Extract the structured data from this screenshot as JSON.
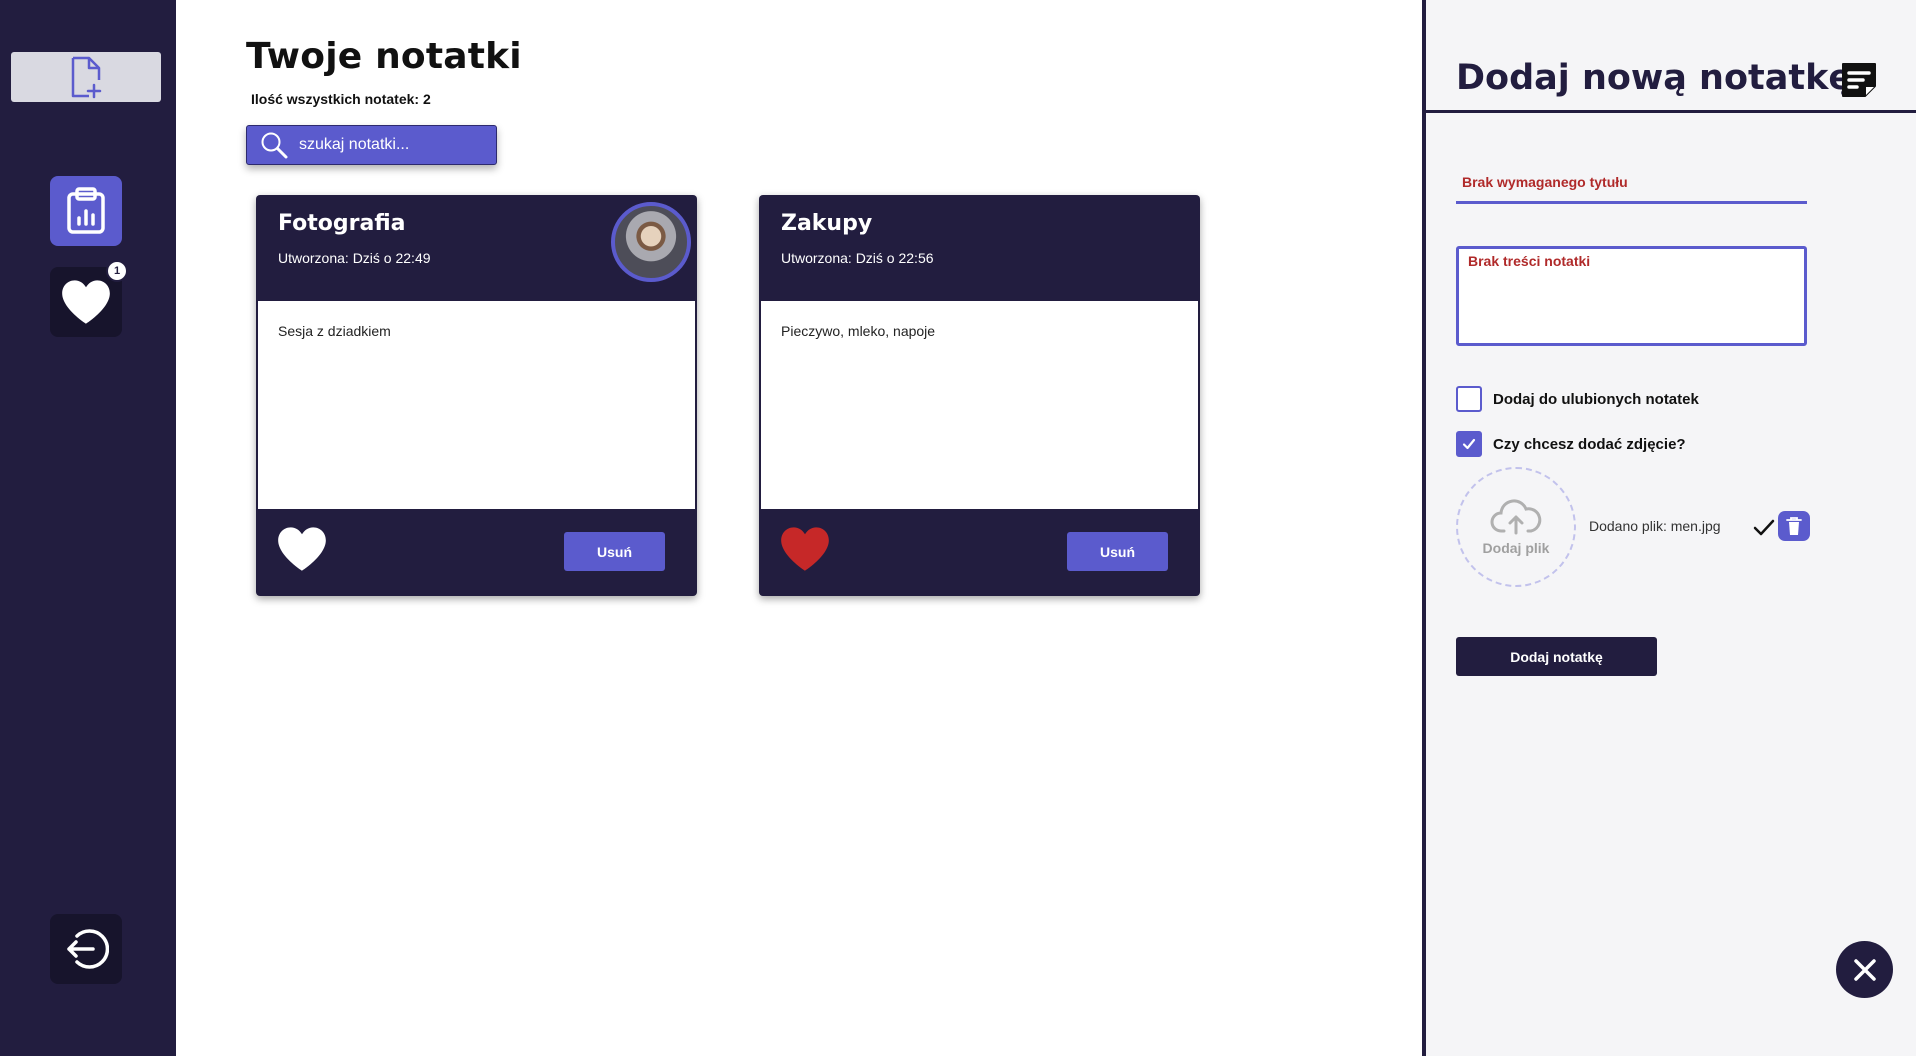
{
  "sidebar": {
    "add_note_icon": "file-plus-icon",
    "stats_icon": "clipboard-chart-icon",
    "favorites_icon": "heart-icon",
    "favorites_badge": "1",
    "logout_icon": "logout-icon"
  },
  "main": {
    "title": "Twoje notatki",
    "count_label": "Ilość wszystkich notatek: 2",
    "search": {
      "placeholder": "szukaj notatki..."
    },
    "notes": [
      {
        "title": "Fotografia",
        "created": "Utworzona: Dziś o 22:49",
        "content": "Sesja z dziadkiem",
        "favorite": false,
        "has_image": true,
        "delete_label": "Usuń"
      },
      {
        "title": "Zakupy",
        "created": "Utworzona: Dziś o 22:56",
        "content": "Pieczywo, mleko, napoje",
        "favorite": true,
        "has_image": false,
        "delete_label": "Usuń"
      }
    ]
  },
  "panel": {
    "title": "Dodaj nową notatkę",
    "title_error": "Brak wymaganego tytułu",
    "content_error": "Brak treści notatki",
    "favorite_checkbox_label": "Dodaj do ulubionych notatek",
    "favorite_checked": false,
    "photo_checkbox_label": "Czy chcesz dodać zdjęcie?",
    "photo_checked": true,
    "upload_label": "Dodaj plik",
    "file_info": "Dodano plik: men.jpg",
    "submit_label": "Dodaj notatkę"
  },
  "colors": {
    "sidebar": "#221d3f",
    "accent": "#5b5bcd",
    "error": "#b02a2a",
    "favorite_heart": "#c62828"
  }
}
